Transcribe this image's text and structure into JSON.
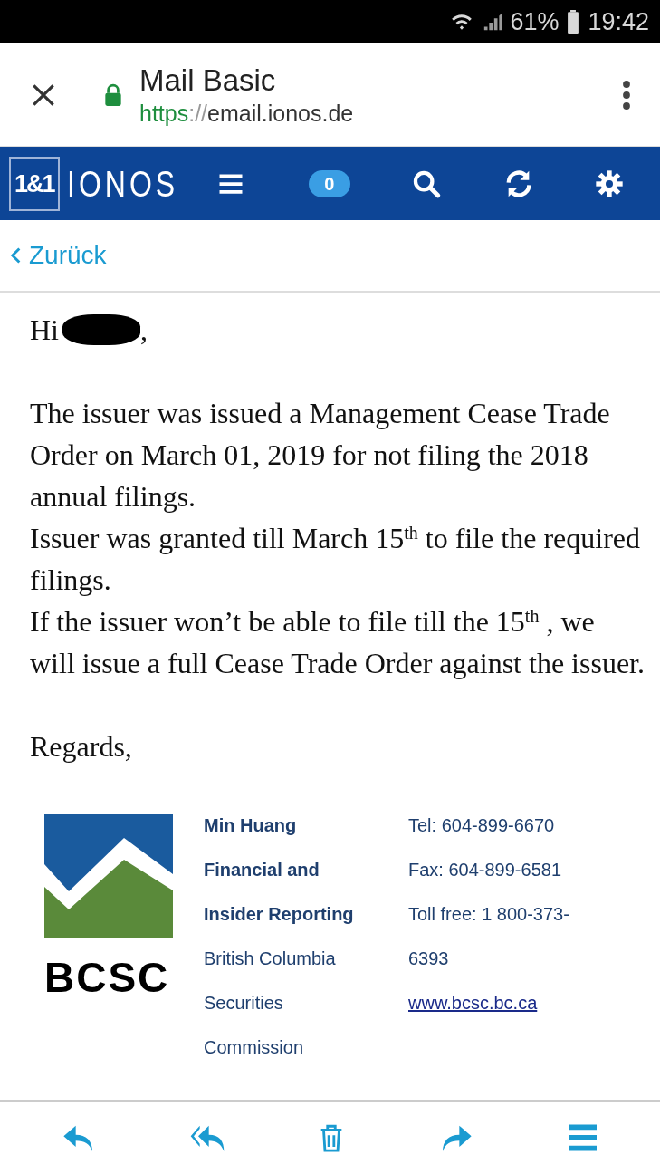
{
  "status_bar": {
    "battery": "61%",
    "time": "19:42"
  },
  "browser": {
    "title": "Mail Basic",
    "url_scheme": "https",
    "url_sep": "://",
    "url_host": "email.ionos.de"
  },
  "app_bar": {
    "logo_box": "1&1",
    "logo_word": "IONOS",
    "unread_count": "0"
  },
  "back": {
    "label": "Zurück"
  },
  "message": {
    "greeting": "Hi",
    "greeting_end": ",",
    "paragraphs": [
      "The issuer was issued a Management Cease Trade Order on March 01, 2019 for not filing the 2018 annual filings.",
      "Issuer was granted till March 15$^{th}$ to file the required filings.",
      "If the issuer won’t be able to file till the 15$^{th}$ , we will issue a full Cease Trade Order against the issuer."
    ],
    "closing": "Regards,",
    "signature": {
      "logo_text": "BCSC",
      "name_lines": [
        "Min Huang",
        "Financial and",
        "Insider Reporting"
      ],
      "org_lines": [
        "British Columbia",
        "Securities",
        "Commission"
      ],
      "contact_lines": [
        "Tel: 604-899-6670",
        "Fax: 604-899-6581",
        "Toll free: 1 800-373-",
        "6393"
      ],
      "website": "www.bcsc.bc.ca"
    }
  }
}
